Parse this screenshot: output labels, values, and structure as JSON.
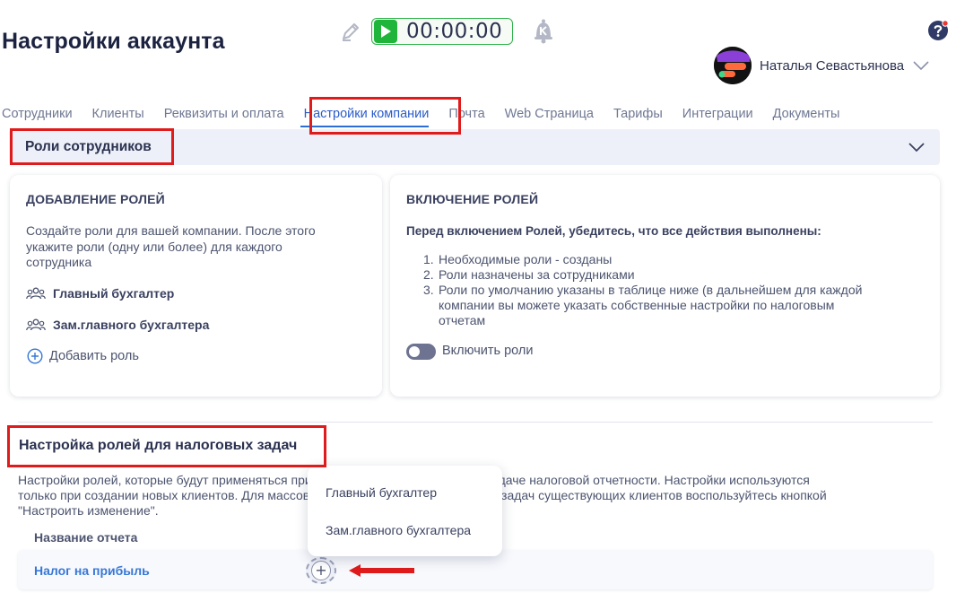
{
  "page": {
    "title": "Настройки аккаунта"
  },
  "timer": {
    "value": "00:00:00"
  },
  "user": {
    "name": "Наталья Севастьянова"
  },
  "tabs": [
    {
      "label": "Сотрудники"
    },
    {
      "label": "Клиенты"
    },
    {
      "label": "Реквизиты и оплата"
    },
    {
      "label": "Настройки компании",
      "active": true
    },
    {
      "label": "Почта"
    },
    {
      "label": "Web Страница"
    },
    {
      "label": "Тарифы"
    },
    {
      "label": "Интеграции"
    },
    {
      "label": "Документы"
    }
  ],
  "roles_section": {
    "title": "Роли сотрудников"
  },
  "add_roles": {
    "heading": "ДОБАВЛЕНИЕ РОЛЕЙ",
    "description_lines": [
      "Создайте роли для вашей компании. После этого",
      "укажите роли (одну или более) для каждого",
      "сотрудника"
    ],
    "roles": [
      "Главный бухгалтер",
      "Зам.главного бухгалтера"
    ],
    "add_label": "Добавить роль"
  },
  "enable_roles": {
    "heading": "ВКЛЮЧЕНИЕ РОЛЕЙ",
    "subheading": "Перед включением Ролей, убедитесь, что все действия выполнены:",
    "steps": [
      {
        "num": "1.",
        "lines": [
          "Необходимые роли - созданы"
        ]
      },
      {
        "num": "2.",
        "lines": [
          "Роли назначены за сотрудниками"
        ]
      },
      {
        "num": "3.",
        "lines": [
          "Роли по умолчанию указаны в таблице ниже (в дальнейшем для каждой",
          "компании вы можете указать собственные настройки по налоговым",
          "отчетам"
        ]
      }
    ],
    "toggle_label": "Включить роли",
    "toggle_on": false
  },
  "tax_section": {
    "title": "Настройка ролей для налоговых задач",
    "description_lines": [
      "Настройки ролей, которые будут применяться при создании налоговых задач по сдаче налоговой отчетности. Настройки используются",
      "только при создании новых клиентов. Для массового изменения ролей налоговых задач существующих клиентов воспользуйтесь кнопкой",
      "\"Настроить изменение\"."
    ],
    "column_header": "Название отчета",
    "rows": [
      {
        "name": "Налог на прибыль"
      }
    ]
  },
  "dropdown": {
    "options": [
      "Главный бухгалтер",
      "Зам.главного бухгалтера"
    ]
  },
  "colors": {
    "accent": "#2b6ed8",
    "highlight": "#e01b1b",
    "timer_green": "#1fb53a"
  }
}
